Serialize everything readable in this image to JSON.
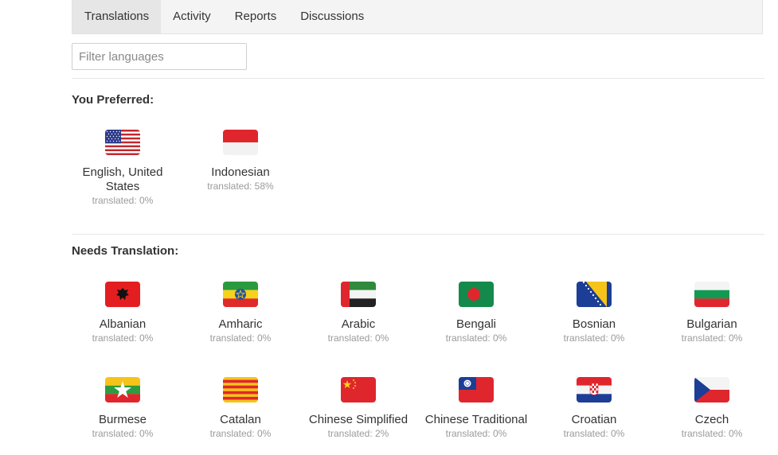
{
  "tabs": [
    {
      "label": "Translations",
      "active": true
    },
    {
      "label": "Activity",
      "active": false
    },
    {
      "label": "Reports",
      "active": false
    },
    {
      "label": "Discussions",
      "active": false
    }
  ],
  "filter": {
    "placeholder": "Filter languages",
    "value": ""
  },
  "preferred": {
    "title": "You Preferred:",
    "languages": [
      {
        "name": "English, United States",
        "status": "translated: 0%",
        "flag": "us-flag-icon"
      },
      {
        "name": "Indonesian",
        "status": "translated: 58%",
        "flag": "indonesia-flag-icon"
      }
    ]
  },
  "needs": {
    "title": "Needs Translation:",
    "languages": [
      {
        "name": "Albanian",
        "status": "translated: 0%",
        "flag": "albania-flag-icon"
      },
      {
        "name": "Amharic",
        "status": "translated: 0%",
        "flag": "ethiopia-flag-icon"
      },
      {
        "name": "Arabic",
        "status": "translated: 0%",
        "flag": "uae-flag-icon"
      },
      {
        "name": "Bengali",
        "status": "translated: 0%",
        "flag": "bangladesh-flag-icon"
      },
      {
        "name": "Bosnian",
        "status": "translated: 0%",
        "flag": "bosnia-flag-icon"
      },
      {
        "name": "Bulgarian",
        "status": "translated: 0%",
        "flag": "bulgaria-flag-icon"
      },
      {
        "name": "Burmese",
        "status": "translated: 0%",
        "flag": "myanmar-flag-icon"
      },
      {
        "name": "Catalan",
        "status": "translated: 0%",
        "flag": "catalonia-flag-icon"
      },
      {
        "name": "Chinese Simplified",
        "status": "translated: 2%",
        "flag": "china-flag-icon"
      },
      {
        "name": "Chinese Traditional",
        "status": "translated: 0%",
        "flag": "taiwan-flag-icon"
      },
      {
        "name": "Croatian",
        "status": "translated: 0%",
        "flag": "croatia-flag-icon"
      },
      {
        "name": "Czech",
        "status": "translated: 0%",
        "flag": "czech-flag-icon"
      }
    ]
  }
}
